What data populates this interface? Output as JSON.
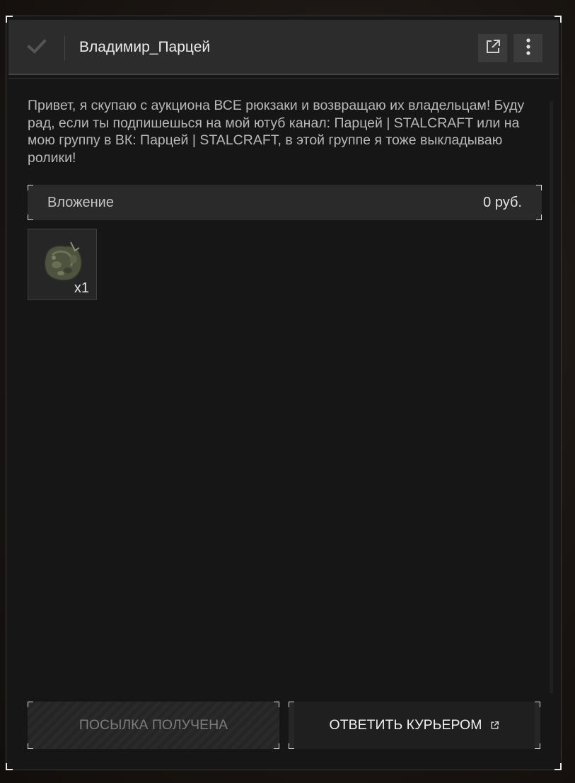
{
  "header": {
    "title": "Владимир_Парцей",
    "check_icon": "check-icon",
    "open_external_icon": "external-link-icon",
    "more_icon": "more-vertical-icon"
  },
  "message": {
    "text": "Привет, я скупаю с аукциона ВСЕ рюкзаки и возвращаю их владельцам! Буду рад, если ты подпишешься на мой ютуб канал:  Парцей  |  STALCRAFT  или на мою группу в ВК:  Парцей  |  STALCRAFT, в этой группе я тоже выкладываю ролики!"
  },
  "attachment": {
    "label": "Вложение",
    "value": "0  руб."
  },
  "items": [
    {
      "icon": "backpack-icon",
      "quantity": "x1"
    }
  ],
  "buttons": {
    "received_label": "ПОСЫЛКА ПОЛУЧЕНА",
    "reply_label": "ОТВЕТИТЬ КУРЬЕРОМ"
  }
}
